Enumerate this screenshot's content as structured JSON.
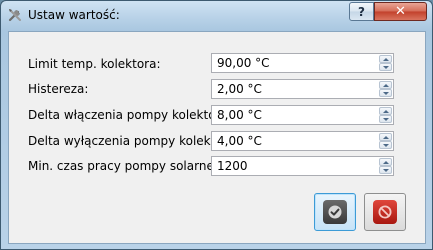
{
  "window": {
    "title": "Ustaw wartość:",
    "help_label": "?",
    "close_label": "✕"
  },
  "fields": [
    {
      "label": "Limit temp. kolektora:",
      "value": "90,00 °C"
    },
    {
      "label": "Histereza:",
      "value": "2,00 °C"
    },
    {
      "label": "Delta włączenia pompy kolektora:",
      "value": "8,00 °C"
    },
    {
      "label": "Delta wyłączenia pompy kolektora:",
      "value": "4,00 °C"
    },
    {
      "label": "Min. czas pracy pompy solarnej [s]:",
      "value": "1200"
    }
  ],
  "buttons": {
    "ok_icon": "checkmark-icon",
    "cancel_icon": "cancel-icon",
    "ok_color": "#4a4a4a",
    "cancel_color": "#c8281e"
  }
}
